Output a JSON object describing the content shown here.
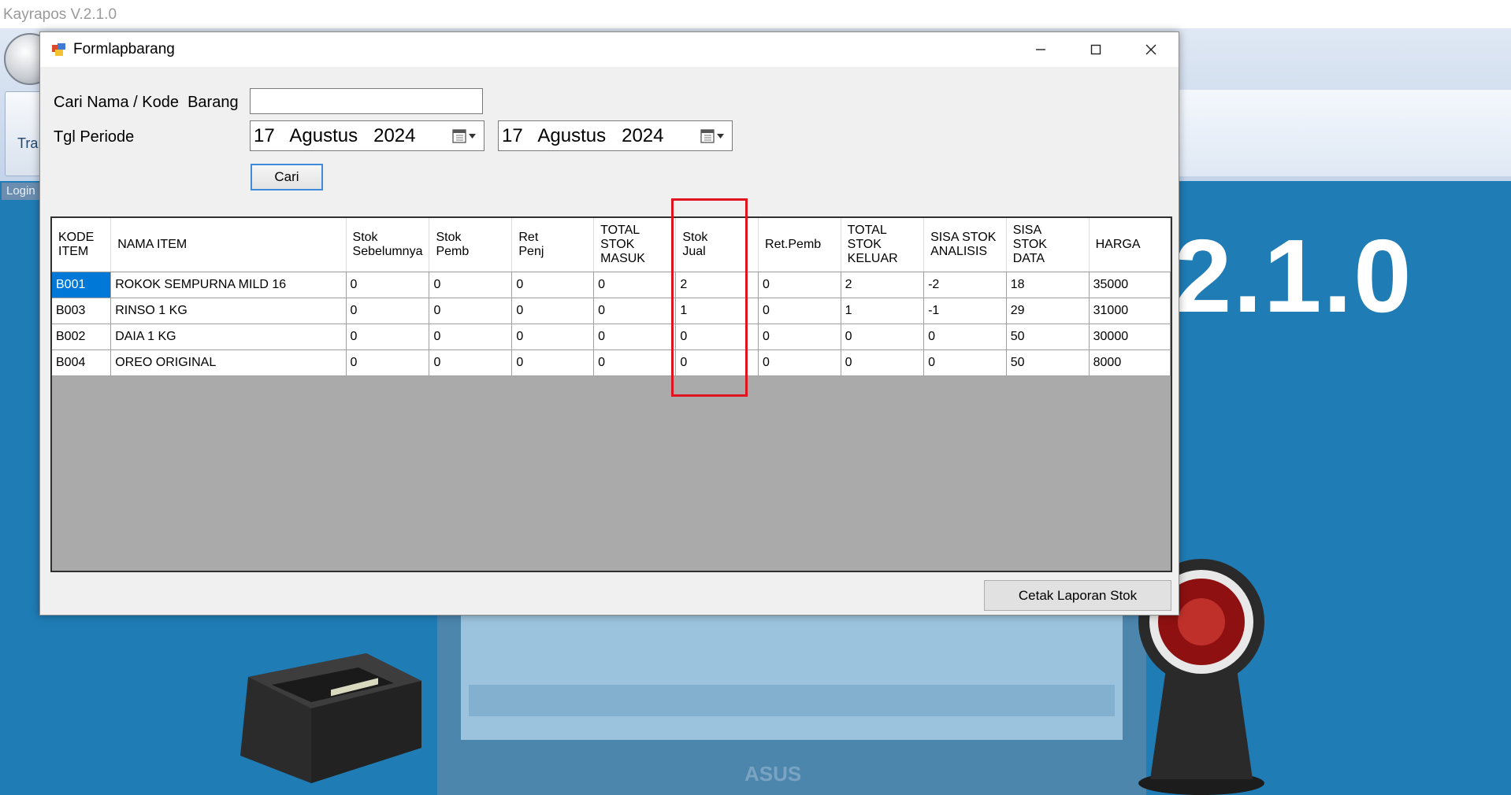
{
  "app": {
    "title": "Kayrapos V.2.1.0",
    "ribbon_tab_label": "Tra",
    "login_tab": "Login",
    "version_text": "2.1.0"
  },
  "dialog": {
    "title": "Formlapbarang",
    "search_label": "Cari Nama / Kode  Barang",
    "search_value": "",
    "periode_label": "Tgl Periode",
    "date_from": "17   Agustus   2024",
    "date_to": "17   Agustus   2024",
    "cari_button": "Cari",
    "cetak_button": "Cetak Laporan Stok"
  },
  "grid": {
    "columns": [
      {
        "l1": "KODE",
        "l2": "ITEM",
        "l3": ""
      },
      {
        "l1": "NAMA ITEM",
        "l2": "",
        "l3": ""
      },
      {
        "l1": "Stok",
        "l2": "Sebelumnya",
        "l3": ""
      },
      {
        "l1": "Stok",
        "l2": "Pemb",
        "l3": ""
      },
      {
        "l1": "Ret",
        "l2": "Penj",
        "l3": ""
      },
      {
        "l1": "TOTAL",
        "l2": "STOK",
        "l3": "MASUK"
      },
      {
        "l1": "Stok",
        "l2": "Jual",
        "l3": ""
      },
      {
        "l1": "Ret.Pemb",
        "l2": "",
        "l3": ""
      },
      {
        "l1": "TOTAL",
        "l2": "STOK",
        "l3": "KELUAR"
      },
      {
        "l1": "SISA STOK",
        "l2": "ANALISIS",
        "l3": ""
      },
      {
        "l1": "SISA",
        "l2": "STOK",
        "l3": "DATA"
      },
      {
        "l1": "HARGA",
        "l2": "",
        "l3": ""
      }
    ],
    "rows": [
      [
        "B001",
        "ROKOK SEMPURNA MILD 16",
        "0",
        "0",
        "0",
        "0",
        "2",
        "0",
        "2",
        "-2",
        "18",
        "35000"
      ],
      [
        "B003",
        "RINSO 1 KG",
        "0",
        "0",
        "0",
        "0",
        "1",
        "0",
        "1",
        "-1",
        "29",
        "31000"
      ],
      [
        "B002",
        "DAIA 1 KG",
        "0",
        "0",
        "0",
        "0",
        "0",
        "0",
        "0",
        "0",
        "50",
        "30000"
      ],
      [
        "B004",
        "OREO ORIGINAL",
        "0",
        "0",
        "0",
        "0",
        "0",
        "0",
        "0",
        "0",
        "50",
        "8000"
      ]
    ]
  },
  "colors": {
    "selection": "#0078d7",
    "highlight_box": "#e0141e",
    "desktop_bg": "#1f7cb5"
  },
  "icons": {
    "title": "form-icon",
    "minimize": "minimize-icon",
    "maximize": "maximize-icon",
    "close": "close-icon",
    "calendar": "calendar-icon"
  }
}
